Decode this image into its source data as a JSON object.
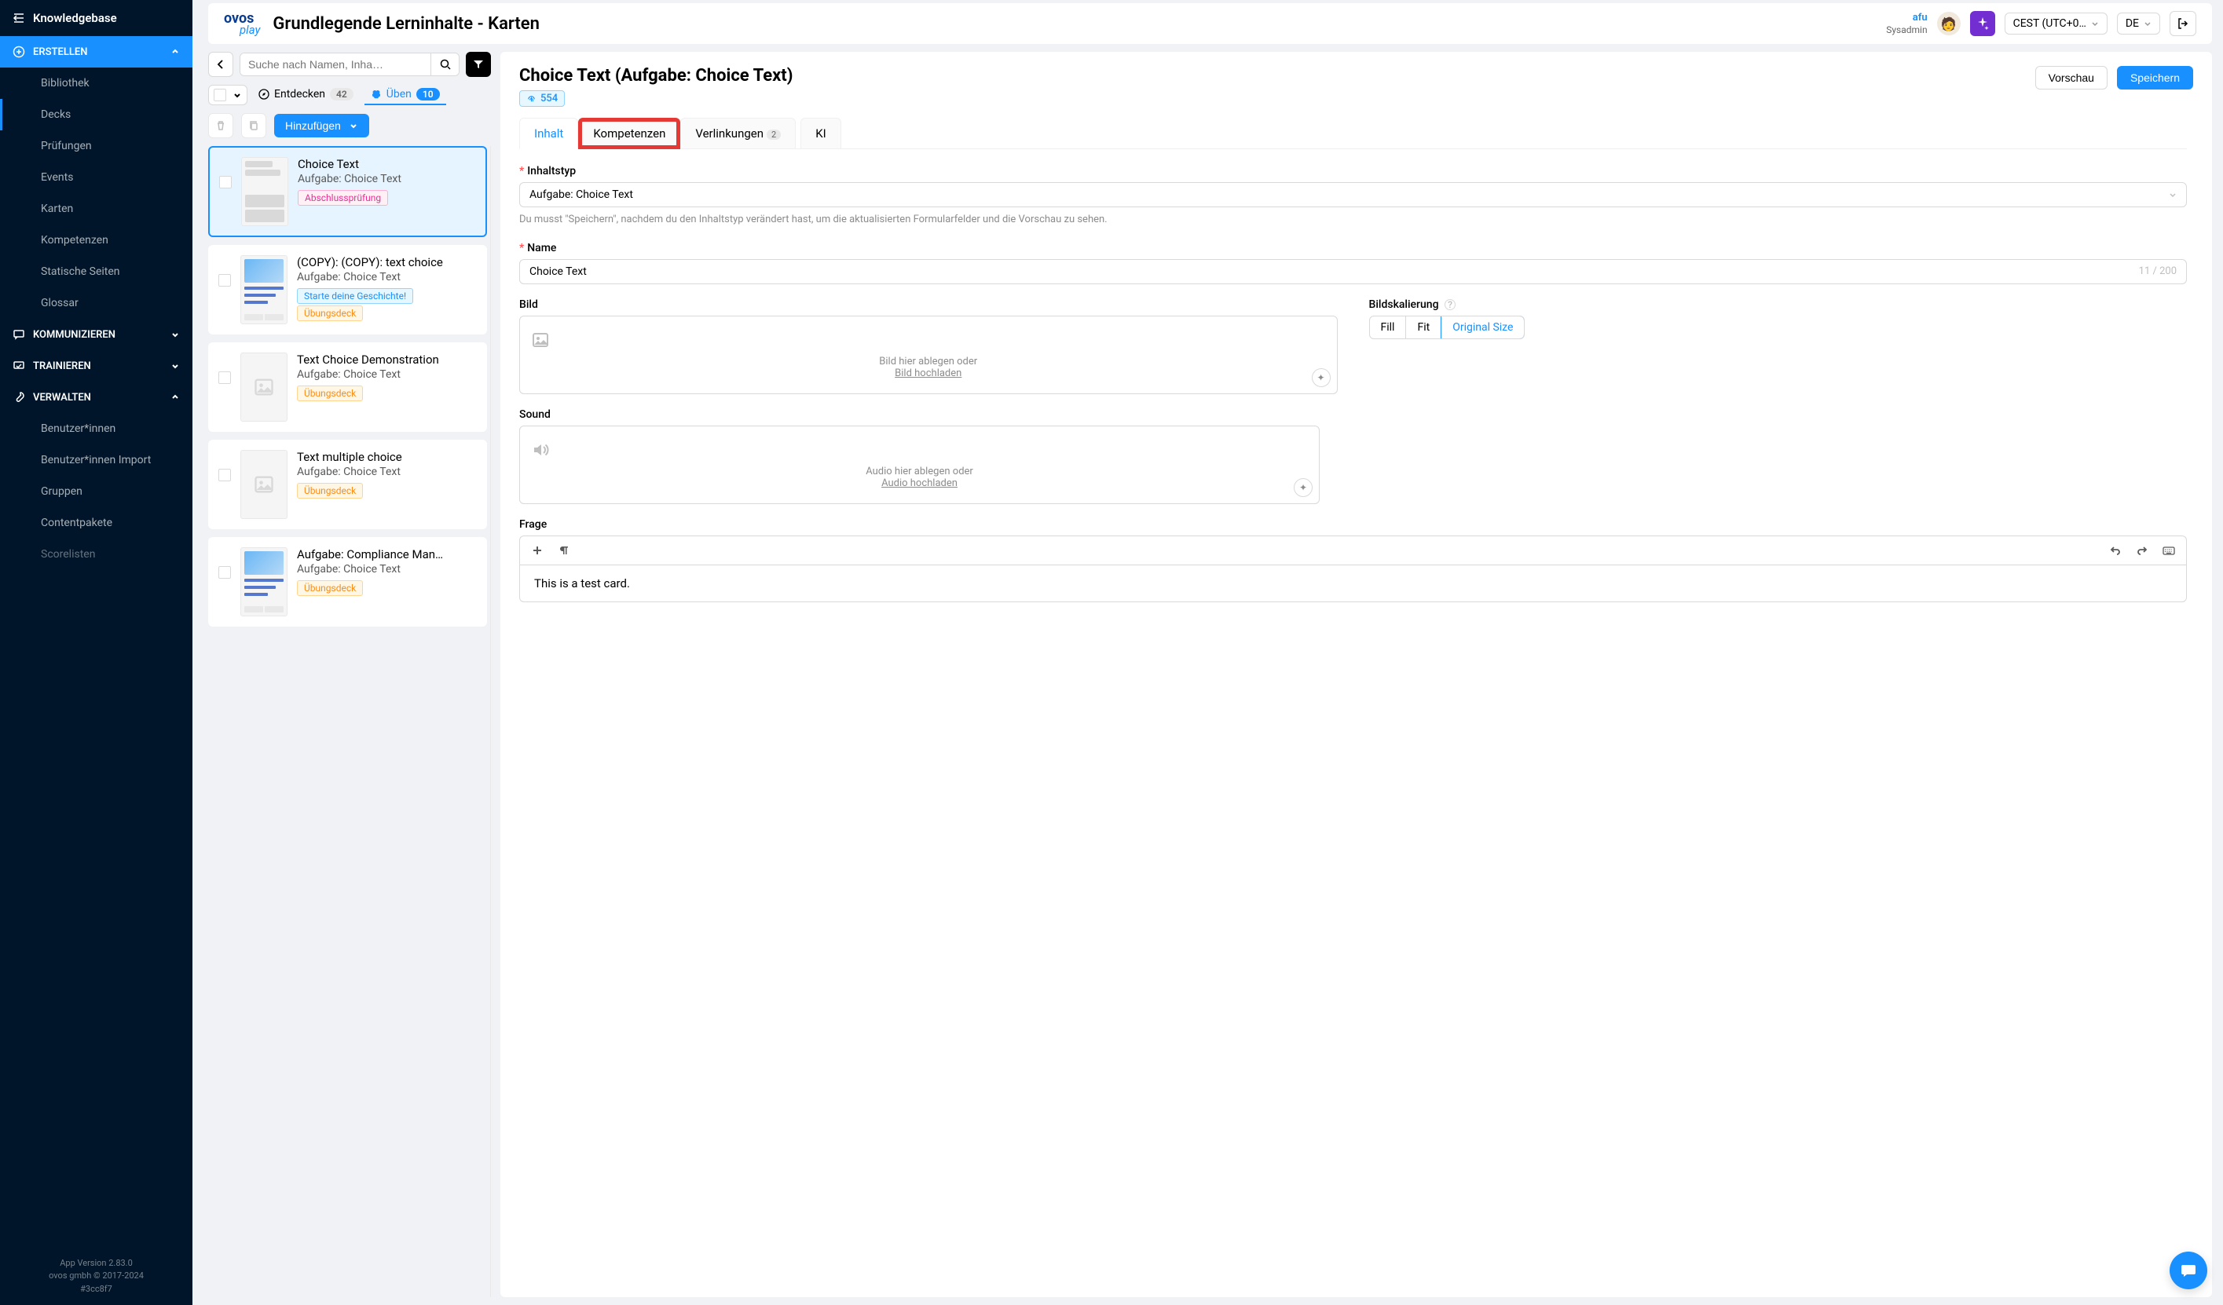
{
  "sidebar": {
    "header": "Knowledgebase",
    "sections": [
      {
        "label": "ERSTELLEN",
        "expanded": true,
        "active": true,
        "items": [
          {
            "label": "Bibliothek"
          },
          {
            "label": "Decks",
            "active": true
          },
          {
            "label": "Prüfungen"
          },
          {
            "label": "Events"
          },
          {
            "label": "Karten"
          },
          {
            "label": "Kompetenzen"
          },
          {
            "label": "Statische Seiten"
          },
          {
            "label": "Glossar"
          }
        ]
      },
      {
        "label": "KOMMUNIZIEREN",
        "expanded": false
      },
      {
        "label": "TRAINIEREN",
        "expanded": false
      },
      {
        "label": "VERWALTEN",
        "expanded": true,
        "items": [
          {
            "label": "Benutzer*innen"
          },
          {
            "label": "Benutzer*innen Import"
          },
          {
            "label": "Gruppen"
          },
          {
            "label": "Contentpakete"
          },
          {
            "label": "Scorelisten"
          }
        ]
      }
    ],
    "footer": {
      "version": "App Version 2.83.0",
      "copyright": "ovos gmbh © 2017-2024",
      "hash": "#3cc8f7"
    }
  },
  "topbar": {
    "logo_main": "ovos",
    "logo_sub": "play",
    "page_title": "Grundlegende Lerninhalte - Karten",
    "user_name": "afu",
    "user_role": "Sysadmin",
    "timezone": "CEST (UTC+0…",
    "language": "DE"
  },
  "list": {
    "search_placeholder": "Suche nach Namen, Inha…",
    "tabs": {
      "entdecken": {
        "label": "Entdecken",
        "count": "42"
      },
      "ueben": {
        "label": "Üben",
        "count": "10"
      }
    },
    "add_label": "Hinzufügen",
    "cards": [
      {
        "title": "Choice Text",
        "subtitle": "Aufgabe: Choice Text",
        "tags": [
          {
            "text": "Abschlussprüfung",
            "color": "pink"
          }
        ],
        "thumb": "choice",
        "selected": true
      },
      {
        "title": "(COPY): (COPY): text choice",
        "subtitle": "Aufgabe: Choice Text",
        "tags": [
          {
            "text": "Starte deine Geschichte!",
            "color": "blue"
          },
          {
            "text": "Übungsdeck",
            "color": "orange"
          }
        ],
        "thumb": "image"
      },
      {
        "title": "Text Choice Demonstration",
        "subtitle": "Aufgabe: Choice Text",
        "tags": [
          {
            "text": "Übungsdeck",
            "color": "orange"
          }
        ],
        "thumb": "placeholder"
      },
      {
        "title": "Text multiple choice",
        "subtitle": "Aufgabe: Choice Text",
        "tags": [
          {
            "text": "Übungsdeck",
            "color": "orange"
          }
        ],
        "thumb": "placeholder"
      },
      {
        "title": "Aufgabe: Compliance Man…",
        "subtitle": "Aufgabe: Choice Text",
        "tags": [
          {
            "text": "Übungsdeck",
            "color": "orange"
          }
        ],
        "thumb": "image"
      }
    ]
  },
  "detail": {
    "title": "Choice Text (Aufgabe: Choice Text)",
    "id_badge": "554",
    "preview_label": "Vorschau",
    "save_label": "Speichern",
    "tabs": [
      {
        "label": "Inhalt",
        "state": "active"
      },
      {
        "label": "Kompetenzen",
        "state": "highlighted"
      },
      {
        "label": "Verlinkungen",
        "badge": "2",
        "state": "inactive"
      },
      {
        "label": "KI",
        "state": "inactive"
      }
    ],
    "field_content_type": {
      "label": "Inhaltstyp",
      "value": "Aufgabe: Choice Text",
      "help": "Du musst \"Speichern\", nachdem du den Inhaltstyp verändert hast, um die aktualisierten Formularfelder und die Vorschau zu sehen."
    },
    "field_name": {
      "label": "Name",
      "value": "Choice Text",
      "counter": "11 / 200"
    },
    "field_image": {
      "label": "Bild",
      "drop_text": "Bild hier ablegen oder",
      "link_text": "Bild hochladen"
    },
    "field_scaling": {
      "label": "Bildskalierung",
      "options": [
        "Fill",
        "Fit",
        "Original Size"
      ],
      "selected": "Original Size"
    },
    "field_sound": {
      "label": "Sound",
      "drop_text": "Audio hier ablegen oder",
      "link_text": "Audio hochladen"
    },
    "field_question": {
      "label": "Frage",
      "content": "This is a test card."
    }
  }
}
